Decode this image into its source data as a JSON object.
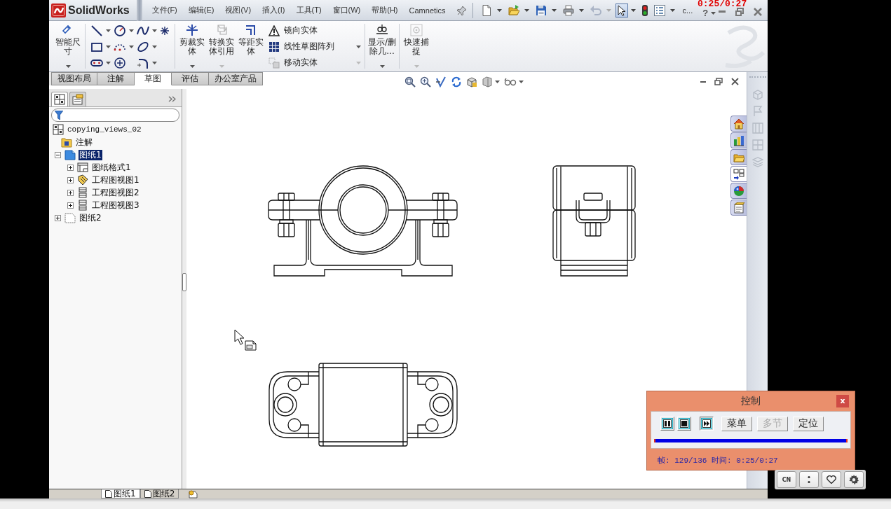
{
  "title_bar": {
    "app_name": "SolidWorks",
    "menu": [
      "文件(F)",
      "编辑(E)",
      "视图(V)",
      "插入(I)",
      "工具(T)",
      "窗口(W)",
      "帮助(H)",
      "Camnetics"
    ],
    "quick_access": [
      {
        "kind": "new",
        "disabled": false,
        "pressed": false
      },
      {
        "kind": "open",
        "disabled": false,
        "pressed": false
      },
      {
        "kind": "save",
        "disabled": false,
        "pressed": false
      },
      {
        "kind": "print",
        "disabled": false,
        "pressed": false
      },
      {
        "kind": "undo",
        "disabled": true,
        "pressed": false
      },
      {
        "kind": "select",
        "disabled": false,
        "pressed": true
      },
      {
        "kind": "traffic_light",
        "disabled": false,
        "pressed": false
      },
      {
        "kind": "options",
        "disabled": false,
        "pressed": false
      }
    ],
    "overflow_label": "c...",
    "help": "?"
  },
  "recording_timer": "0:25/0:27",
  "ribbon": {
    "dimension_tool": {
      "label": "智能尺寸",
      "disabled": false
    },
    "edit_tools": [
      {
        "label": "剪裁实体",
        "disabled": false
      },
      {
        "label": "转换实体引用",
        "disabled": true
      },
      {
        "label": "等距实体",
        "disabled": false
      }
    ],
    "pattern_tools": [
      {
        "label": "镜向实体",
        "disabled": false
      },
      {
        "label": "线性草图阵列",
        "disabled": false
      },
      {
        "label": "移动实体",
        "disabled": true
      }
    ],
    "relation_tools": [
      {
        "label": "显示/删除几...",
        "disabled": false
      },
      {
        "label": "快速捕捉",
        "disabled": true
      }
    ]
  },
  "command_tabs": [
    {
      "label": "视图布局",
      "selected": false
    },
    {
      "label": "注解",
      "selected": false
    },
    {
      "label": "草图",
      "selected": true
    },
    {
      "label": "评估",
      "selected": false
    },
    {
      "label": "办公室产品",
      "selected": false
    }
  ],
  "feature_manager": {
    "tabs": [
      {
        "selected": true
      },
      {
        "selected": false
      }
    ],
    "tree": {
      "label": "copying_views_02",
      "kind": "document",
      "selected": false,
      "children": [
        {
          "label": "注解",
          "kind": "annotations",
          "selected": false
        },
        {
          "label": "图纸1",
          "kind": "sheet",
          "selected": true,
          "expanded": true,
          "children": [
            {
              "label": "图纸格式1",
              "kind": "sheet_format",
              "selected": false,
              "expanded": false
            },
            {
              "label": "工程图视图1",
              "kind": "model_view",
              "selected": false,
              "expanded": false
            },
            {
              "label": "工程图视图2",
              "kind": "projected_view",
              "selected": false,
              "expanded": false
            },
            {
              "label": "工程图视图3",
              "kind": "projected_view",
              "selected": false,
              "expanded": false
            }
          ]
        },
        {
          "label": "图纸2",
          "kind": "empty_sheet",
          "selected": false,
          "expanded": false
        }
      ]
    }
  },
  "task_pane": {
    "tabs": [
      {
        "kind": "home",
        "selected": false
      },
      {
        "kind": "library",
        "selected": false
      },
      {
        "kind": "folder",
        "selected": false
      },
      {
        "kind": "view_palette",
        "selected": true
      },
      {
        "kind": "appearance",
        "selected": false
      },
      {
        "kind": "properties",
        "selected": false
      }
    ]
  },
  "sheet_tabs": [
    {
      "label": "图纸1",
      "selected": true
    },
    {
      "label": "图纸2",
      "selected": false
    }
  ],
  "player_control": {
    "title": "控制",
    "close": "x",
    "icon_buttons": [
      {
        "kind": "pause",
        "selected": false
      },
      {
        "kind": "stop",
        "selected": false
      },
      {
        "kind": "fast_forward",
        "selected": true
      }
    ],
    "text_buttons": [
      {
        "label": "菜单",
        "disabled": false
      },
      {
        "label": "多节",
        "disabled": true
      },
      {
        "label": "定位",
        "disabled": false
      }
    ],
    "progress": {
      "level": 1
    },
    "status": "帧: 129/136 时间: 0:25/0:27"
  },
  "player_bar": {
    "buttons": [
      {
        "kind": "text",
        "label": "CN"
      },
      {
        "kind": "dots"
      },
      {
        "kind": "heart"
      },
      {
        "kind": "gear"
      }
    ]
  }
}
